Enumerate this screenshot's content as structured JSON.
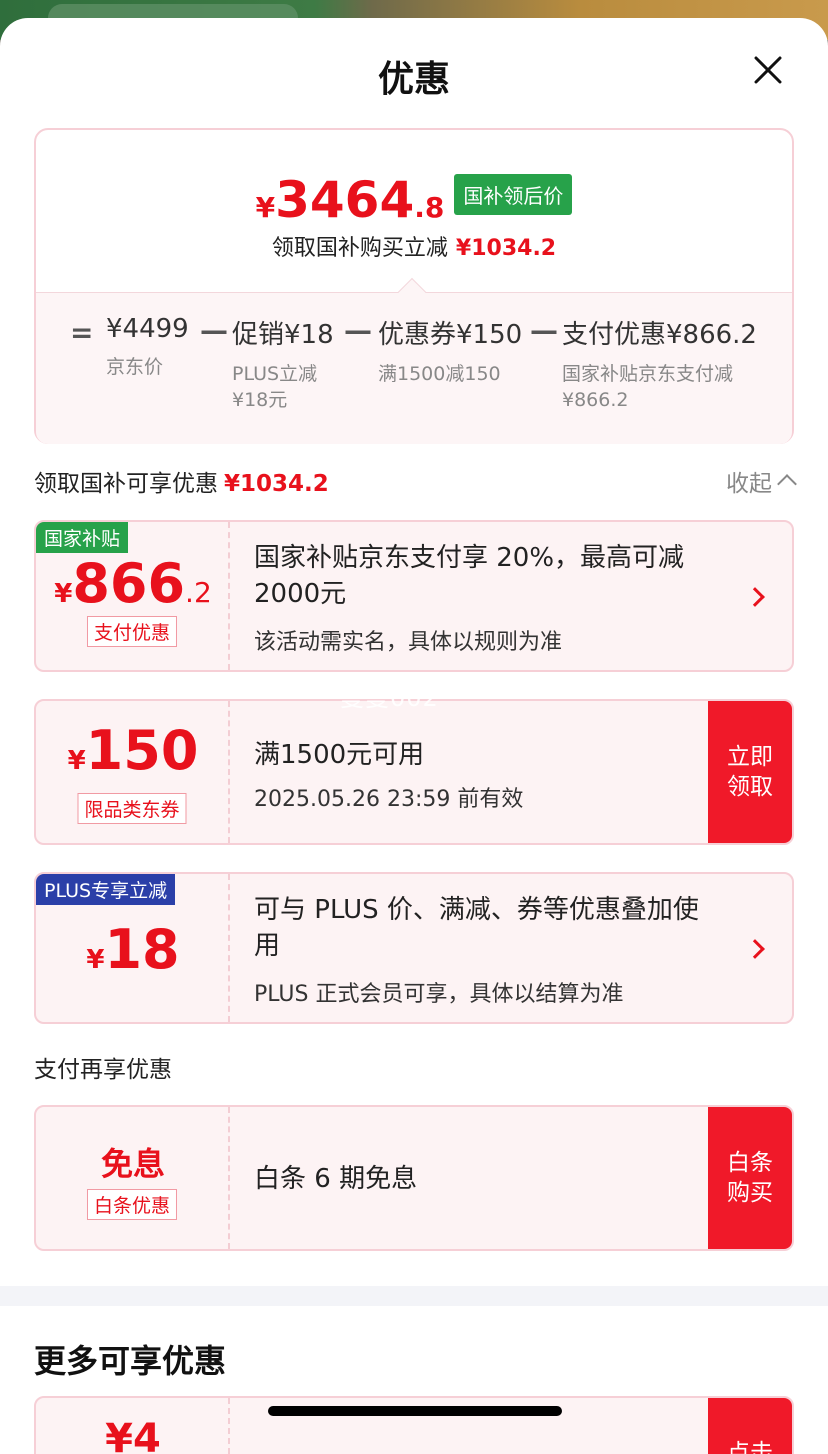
{
  "header": {
    "title": "优惠"
  },
  "summary": {
    "price_yen": "¥",
    "price_int": "3464",
    "price_dec": ".8",
    "price_badge": "国补领后价",
    "reduce_text": "领取国补购买立减",
    "reduce_amount": "¥1034.2",
    "calc": {
      "eq": "=",
      "minus": "—",
      "items": [
        {
          "amount": "¥4499",
          "sub": "京东价"
        },
        {
          "amount": "促销¥18",
          "sub": "PLUS立减 ¥18元"
        },
        {
          "amount": "优惠券¥150",
          "sub": "满1500减150"
        },
        {
          "amount": "支付优惠¥866.2",
          "sub": "国家补贴京东支付减 ¥866.2"
        }
      ]
    }
  },
  "section1": {
    "label": "领取国补可享优惠",
    "amount": "¥1034.2",
    "collapse_label": "收起"
  },
  "coupons": [
    {
      "corner_tag": "国家补贴",
      "yen": "¥",
      "int": "866",
      "dec": ".2",
      "tag": "支付优惠",
      "title": "国家补贴京东支付享 20%，最高可减 2000元",
      "sub": "该活动需实名，具体以规则为准"
    },
    {
      "yen": "¥",
      "int": "150",
      "tag": "限品类东券",
      "title": "满1500元可用",
      "sub": "2025.05.26 23:59 前有效",
      "button": [
        "立即",
        "领取"
      ]
    },
    {
      "corner_tag": "PLUS专享立减",
      "yen": "¥",
      "int": "18",
      "title": "可与 PLUS 价、满减、券等优惠叠加使用",
      "sub": "PLUS 正式会员可享，具体以结算为准"
    }
  ],
  "section2": {
    "label": "支付再享优惠"
  },
  "pay_coupon": {
    "big": "免息",
    "tag": "白条优惠",
    "title": "白条 6 期免息",
    "button": [
      "白条",
      "购买"
    ]
  },
  "more": {
    "title": "更多可享优惠",
    "partial_amount": "¥4",
    "partial_button": "点击"
  },
  "watermark": "曼曼002",
  "colors": {
    "accent": "#e8111c",
    "green": "#27a24a",
    "blue": "#2b3fa8",
    "card_bg": "#fdf3f4"
  }
}
